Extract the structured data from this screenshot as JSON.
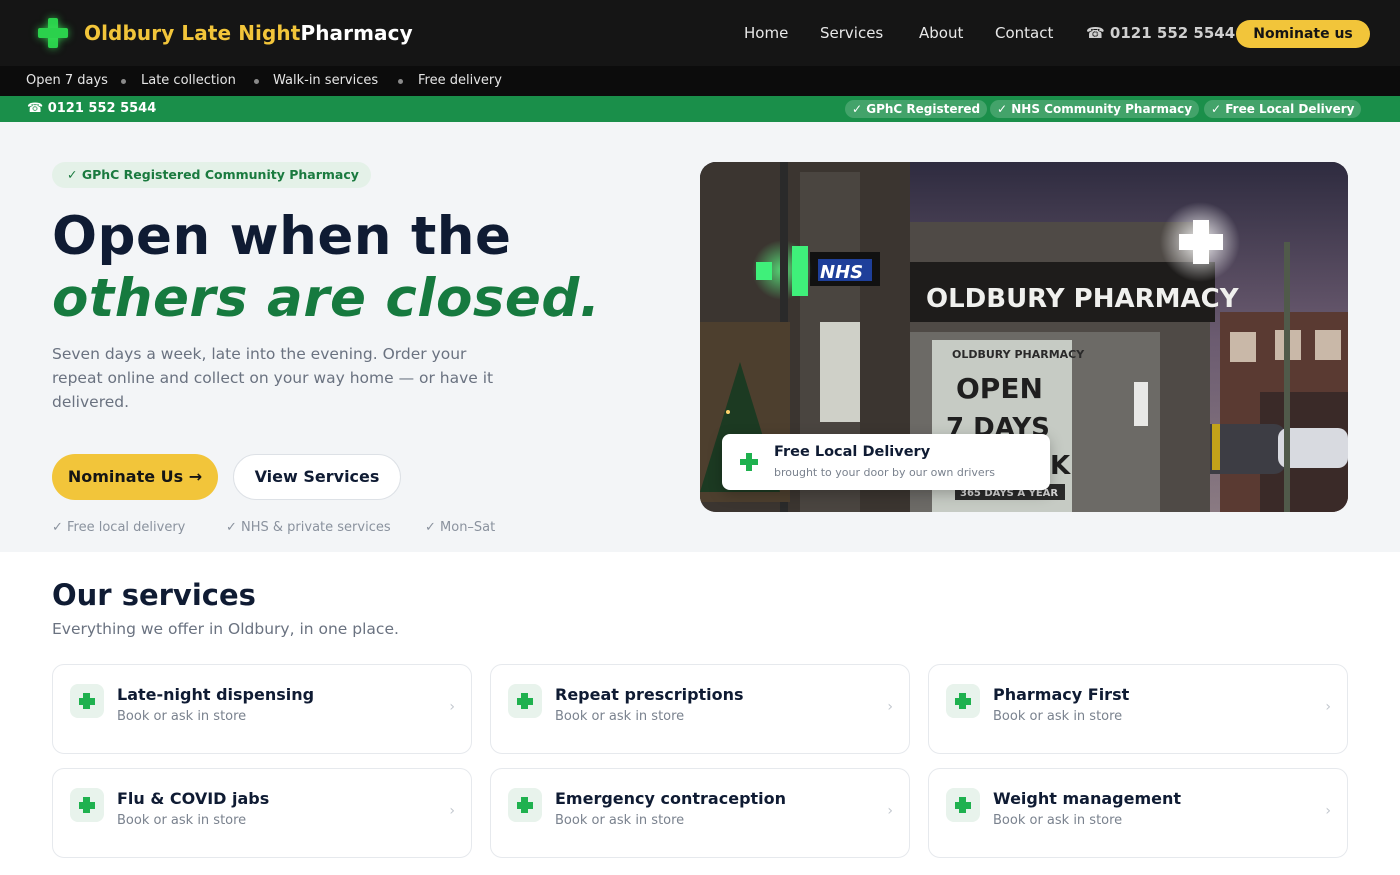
{
  "brand": {
    "name_accent": "Oldbury Late Night",
    "name_plain": "Pharmacy",
    "icon": "green-cross-icon"
  },
  "nav": {
    "links": [
      "Home",
      "Services",
      "About",
      "Contact"
    ],
    "phone": "☎ 0121 552 5544",
    "cta": "Nominate us"
  },
  "subbar": {
    "items": [
      "Open 7 days",
      "Late collection",
      "Walk-in services",
      "Free delivery"
    ]
  },
  "greenbar": {
    "phone": "☎ 0121 552 5544",
    "badges": [
      "✓ GPhC Registered",
      "✓ NHS Community Pharmacy",
      "✓ Free Local Delivery"
    ]
  },
  "hero": {
    "pill": "✓ GPhC Registered Community Pharmacy",
    "headline_line1": "Open when the",
    "headline_line2": "others are closed.",
    "paragraph": "Seven days a week, late into the evening. Order your repeat online and collect on your way home — or have it delivered.",
    "primary_button": "Nominate Us →",
    "secondary_button": "View Services",
    "checks": [
      "✓ Free local delivery",
      "✓ NHS & private services",
      "✓ Mon–Sat"
    ],
    "image_signs": {
      "nhs": "NHS",
      "storefront": "OLDBURY PHARMACY",
      "window_brand": "OLDBURY PHARMACY",
      "window_open": "OPEN",
      "window_days": "7 DAYS",
      "window_k": "K",
      "window_year": "365 DAYS A YEAR"
    },
    "delivery_card": {
      "title": "Free Local Delivery",
      "subtitle": "brought to your door by our own drivers"
    }
  },
  "services": {
    "heading": "Our services",
    "subheading": "Everything we offer in Oldbury, in one place.",
    "cards": [
      {
        "title": "Late-night dispensing",
        "subtitle": "Book or ask in store"
      },
      {
        "title": "Repeat prescriptions",
        "subtitle": "Book or ask in store"
      },
      {
        "title": "Pharmacy First",
        "subtitle": "Book or ask in store"
      },
      {
        "title": "Flu & COVID jabs",
        "subtitle": "Book or ask in store"
      },
      {
        "title": "Emergency contraception",
        "subtitle": "Book or ask in store"
      },
      {
        "title": "Weight management",
        "subtitle": "Book or ask in store"
      }
    ],
    "chevron": "›"
  },
  "colors": {
    "accent_yellow": "#f2c53a",
    "brand_green": "#1a8f4a",
    "dark": "#151515"
  }
}
